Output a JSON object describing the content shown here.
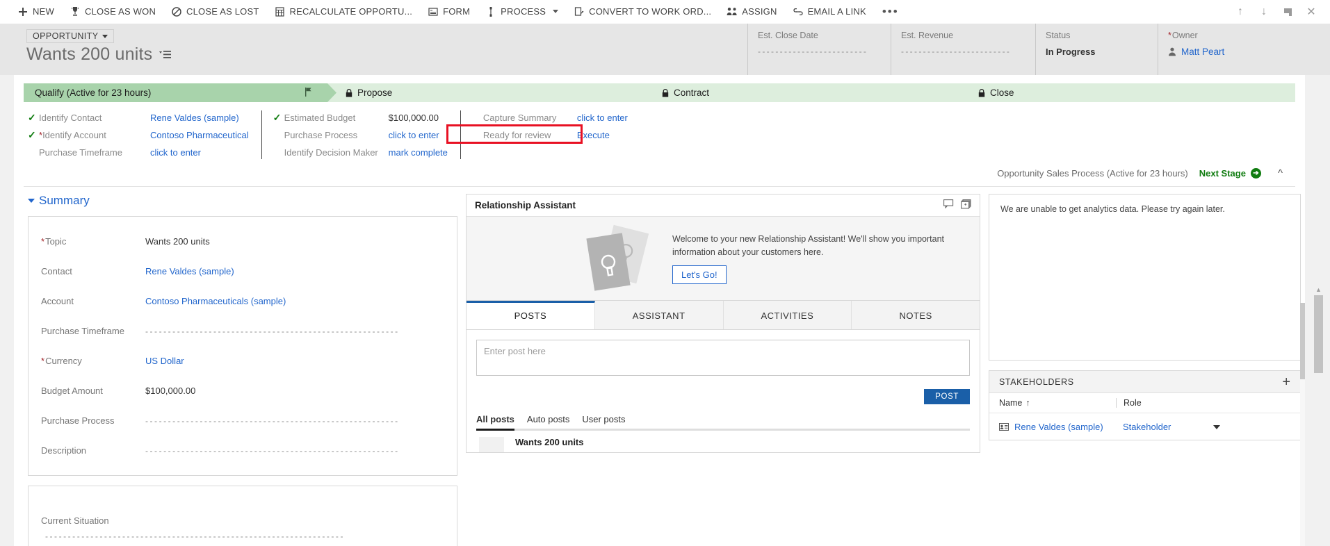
{
  "commandbar": {
    "items": [
      {
        "label": "NEW",
        "icon": "plus-icon"
      },
      {
        "label": "CLOSE AS WON",
        "icon": "trophy-icon"
      },
      {
        "label": "CLOSE AS LOST",
        "icon": "ban-icon"
      },
      {
        "label": "RECALCULATE OPPORTU...",
        "icon": "calculator-icon"
      },
      {
        "label": "FORM",
        "icon": "form-icon"
      },
      {
        "label": "PROCESS",
        "icon": "process-icon",
        "dropdown": true
      },
      {
        "label": "CONVERT TO WORK ORD...",
        "icon": "convert-icon"
      },
      {
        "label": "ASSIGN",
        "icon": "assign-icon"
      },
      {
        "label": "EMAIL A LINK",
        "icon": "link-icon"
      }
    ],
    "overflow": "•••",
    "window_buttons": [
      {
        "name": "up-arrow-icon",
        "glyph": "↑"
      },
      {
        "name": "down-arrow-icon",
        "glyph": "↓"
      },
      {
        "name": "popout-icon",
        "glyph": "⬈"
      },
      {
        "name": "close-icon",
        "glyph": "✕"
      }
    ]
  },
  "record_header": {
    "entity_type": "OPPORTUNITY",
    "title": "Wants 200 units",
    "fields": [
      {
        "label": "Est. Close Date",
        "value": "",
        "dashes": "- - - - - - - - - - - - - - - - - - - - - - - - -",
        "required": false
      },
      {
        "label": "Est. Revenue",
        "value": "",
        "dashes": "- - - - - - - - - - - - - - - - - - - - - - - - -",
        "required": false
      },
      {
        "label": "Status",
        "value": "In Progress",
        "required": false
      },
      {
        "label": "Owner",
        "value": "Matt Peart",
        "required": true
      }
    ]
  },
  "process_flow": {
    "stages": [
      {
        "label": "Qualify (Active for 23 hours)",
        "state": "active",
        "locked": false
      },
      {
        "label": "Propose",
        "state": "inactive",
        "locked": true
      },
      {
        "label": "Contract",
        "state": "inactive",
        "locked": true
      },
      {
        "label": "Close",
        "state": "inactive",
        "locked": true
      }
    ],
    "steps_col1": [
      {
        "check": "✓",
        "name": "Identify Contact",
        "required": false,
        "value": "Rene Valdes (sample)",
        "link": true
      },
      {
        "check": "✓",
        "name": "Identify Account",
        "required": true,
        "value": "Contoso Pharmaceutical",
        "link": true
      },
      {
        "check": "",
        "name": "Purchase Timeframe",
        "required": false,
        "value": "click to enter",
        "link": true
      }
    ],
    "steps_col2": [
      {
        "check": "✓",
        "name": "Estimated Budget",
        "required": false,
        "value": "$100,000.00",
        "link": false
      },
      {
        "check": "",
        "name": "Purchase Process",
        "required": false,
        "value": "click to enter",
        "link": true
      },
      {
        "check": "",
        "name": "Identify Decision Maker",
        "required": false,
        "value": "mark complete",
        "link": true
      }
    ],
    "steps_col3": [
      {
        "check": "",
        "name": "Capture Summary",
        "required": false,
        "value": "click to enter",
        "link": true
      },
      {
        "check": "",
        "name": "Ready for review",
        "required": false,
        "value": "Execute",
        "link": true
      }
    ],
    "footer_process_name": "Opportunity Sales Process (Active for 23 hours)",
    "next_stage_label": "Next Stage",
    "highlight_color": "#e81123"
  },
  "summary": {
    "section_title": "Summary",
    "fields": [
      {
        "label": "Topic",
        "required": true,
        "value": "Wants 200 units",
        "link": false
      },
      {
        "label": "Contact",
        "required": false,
        "value": "Rene Valdes (sample)",
        "link": true
      },
      {
        "label": "Account",
        "required": false,
        "value": "Contoso Pharmaceuticals (sample)",
        "link": true
      },
      {
        "label": "Purchase Timeframe",
        "required": false,
        "value": "",
        "link": false
      },
      {
        "label": "Currency",
        "required": true,
        "value": "US Dollar",
        "link": true
      },
      {
        "label": "Budget Amount",
        "required": false,
        "value": "$100,000.00",
        "link": false
      },
      {
        "label": "Purchase Process",
        "required": false,
        "value": "",
        "link": false
      },
      {
        "label": "Description",
        "required": false,
        "value": "",
        "link": false
      }
    ],
    "current_situation_label": "Current Situation"
  },
  "relationship_assistant": {
    "title": "Relationship Assistant",
    "welcome_text": "Welcome to your new Relationship Assistant! We'll show you important information about your customers here.",
    "cta_label": "Let's Go!",
    "header_icons": [
      "feedback-icon",
      "cards-icon"
    ]
  },
  "social_pane": {
    "tabs": [
      {
        "label": "POSTS",
        "selected": true
      },
      {
        "label": "ASSISTANT",
        "selected": false
      },
      {
        "label": "ACTIVITIES",
        "selected": false
      },
      {
        "label": "NOTES",
        "selected": false
      }
    ],
    "post_placeholder": "Enter post here",
    "post_value": "",
    "post_button": "POST",
    "filters": [
      {
        "label": "All posts",
        "selected": true
      },
      {
        "label": "Auto posts",
        "selected": false
      },
      {
        "label": "User posts",
        "selected": false
      }
    ],
    "posts": [
      {
        "title": "Wants 200 units"
      }
    ]
  },
  "analytics": {
    "message": "We are unable to get analytics data. Please try again later."
  },
  "stakeholders": {
    "title": "STAKEHOLDERS",
    "add_label": "+",
    "columns": [
      "Name",
      "Role",
      ""
    ],
    "sort_glyph": "↑",
    "rows": [
      {
        "name": "Rene Valdes (sample)",
        "role": "Stakeholder"
      }
    ]
  }
}
